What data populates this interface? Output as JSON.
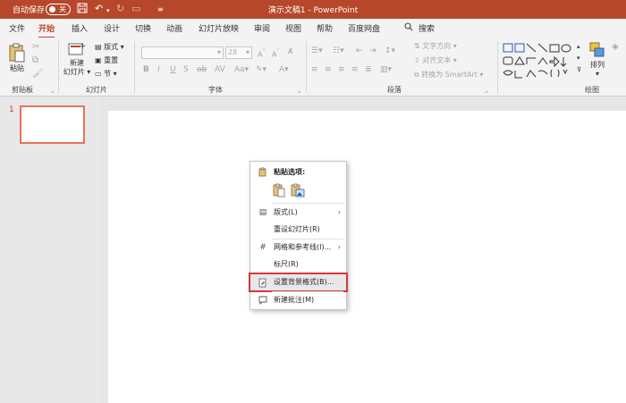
{
  "titlebar": {
    "autosave_label": "自动保存",
    "autosave_state": "关",
    "doc_title": "演示文稿1 - PowerPoint",
    "icons": [
      "save-icon",
      "undo-icon",
      "redo-icon",
      "present-icon",
      "customize-icon"
    ]
  },
  "tabs": [
    "文件",
    "开始",
    "插入",
    "设计",
    "切换",
    "动画",
    "幻灯片放映",
    "审阅",
    "视图",
    "帮助",
    "百度网盘"
  ],
  "active_tab": "开始",
  "search_label": "搜索",
  "ribbon": {
    "clipboard": {
      "paste": "粘贴",
      "group": "剪贴板"
    },
    "slides": {
      "new_line1": "新建",
      "new_line2": "幻灯片",
      "layout": "版式",
      "reset": "重置",
      "section": "节",
      "group": "幻灯片"
    },
    "font": {
      "size": "28",
      "group": "字体"
    },
    "paragraph": {
      "text_direction": "文字方向",
      "align_text": "对齐文本",
      "smartart": "转换为 SmartArt",
      "group": "段落"
    },
    "drawing": {
      "arrange": "排列",
      "group": "绘图"
    }
  },
  "slide_panel": {
    "number": "1"
  },
  "context_menu": {
    "paste_options": "粘贴选项:",
    "items": [
      {
        "label": "版式(L)",
        "icon": "layout-icon",
        "submenu": true
      },
      {
        "label": "重设幻灯片(R)",
        "icon": "",
        "submenu": false
      },
      {
        "label": "网格和参考线(I)...",
        "icon": "grid-icon",
        "submenu": true
      },
      {
        "label": "标尺(R)",
        "icon": "",
        "submenu": false
      },
      {
        "label": "设置背景格式(B)...",
        "icon": "format-background-icon",
        "submenu": false,
        "highlighted": true
      },
      {
        "label": "新建批注(M)",
        "icon": "comment-icon",
        "submenu": false
      }
    ]
  },
  "colors": {
    "accent": "#b7472a",
    "highlight_border": "#d9363e",
    "thumb_border": "#e8735a"
  }
}
